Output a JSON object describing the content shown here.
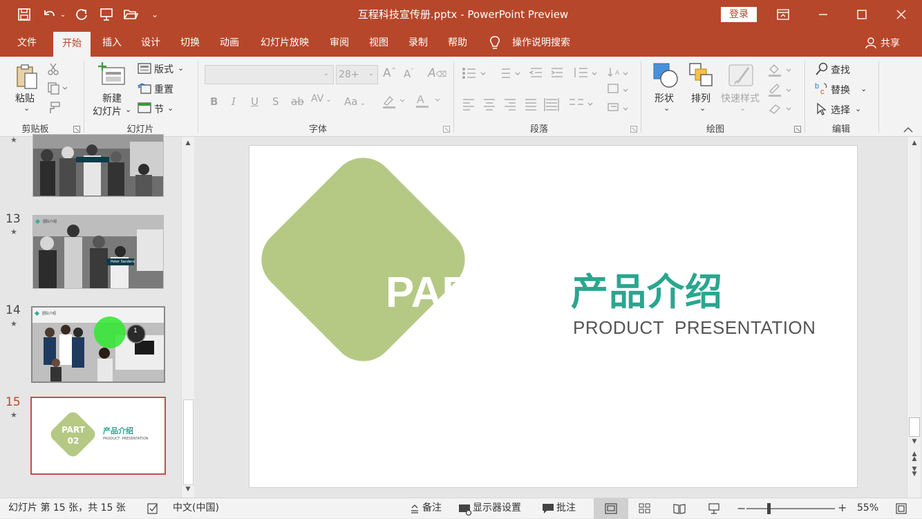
{
  "window": {
    "title": "互程科技宣传册.pptx  -  PowerPoint Preview",
    "login_label": "登录",
    "share_label": "共享"
  },
  "tabs": [
    {
      "label": "文件"
    },
    {
      "label": "开始"
    },
    {
      "label": "插入"
    },
    {
      "label": "设计"
    },
    {
      "label": "切换"
    },
    {
      "label": "动画"
    },
    {
      "label": "幻灯片放映"
    },
    {
      "label": "审阅"
    },
    {
      "label": "视图"
    },
    {
      "label": "录制"
    },
    {
      "label": "帮助"
    }
  ],
  "tell_me": "操作说明搜索",
  "ribbon": {
    "clipboard": {
      "paste": "粘贴",
      "label": "剪贴板"
    },
    "slides": {
      "new_line1": "新建",
      "new_line2": "幻灯片",
      "layout": "版式",
      "reset": "重置",
      "section": "节",
      "label": "幻灯片"
    },
    "font": {
      "size_placeholder": "28+",
      "label": "字体"
    },
    "paragraph": {
      "label": "段落"
    },
    "drawing": {
      "shapes": "形状",
      "arrange": "排列",
      "quick_styles": "快速样式",
      "label": "绘图"
    },
    "editing": {
      "find": "查找",
      "replace": "替换",
      "select": "选择",
      "label": "编辑"
    }
  },
  "thumbnails": [
    {
      "number": "13",
      "caption": "团队介绍",
      "name_tag": "Peter Sanders"
    },
    {
      "number": "14",
      "caption": "团队介绍",
      "badge": "1"
    },
    {
      "number": "15",
      "part": "PART",
      "part_no": "02",
      "title": "产品介绍",
      "subtitle": "PRODUCT  PRESENTATION"
    }
  ],
  "slide": {
    "part": "PART",
    "part_no": "02",
    "title": "产品介绍",
    "subtitle": "PRODUCT  PRESENTATION"
  },
  "status": {
    "slide_info": "幻灯片 第 15 张，共 15 张",
    "language": "中文(中国)",
    "notes": "备注",
    "display_settings": "显示器设置",
    "comments": "批注",
    "zoom": "55%",
    "zoom_fraction": 0.55
  },
  "colors": {
    "brand": "#b7472a",
    "diamond": "#b5c985",
    "title_teal": "#2aa68f",
    "subtitle_gray": "#555555"
  }
}
